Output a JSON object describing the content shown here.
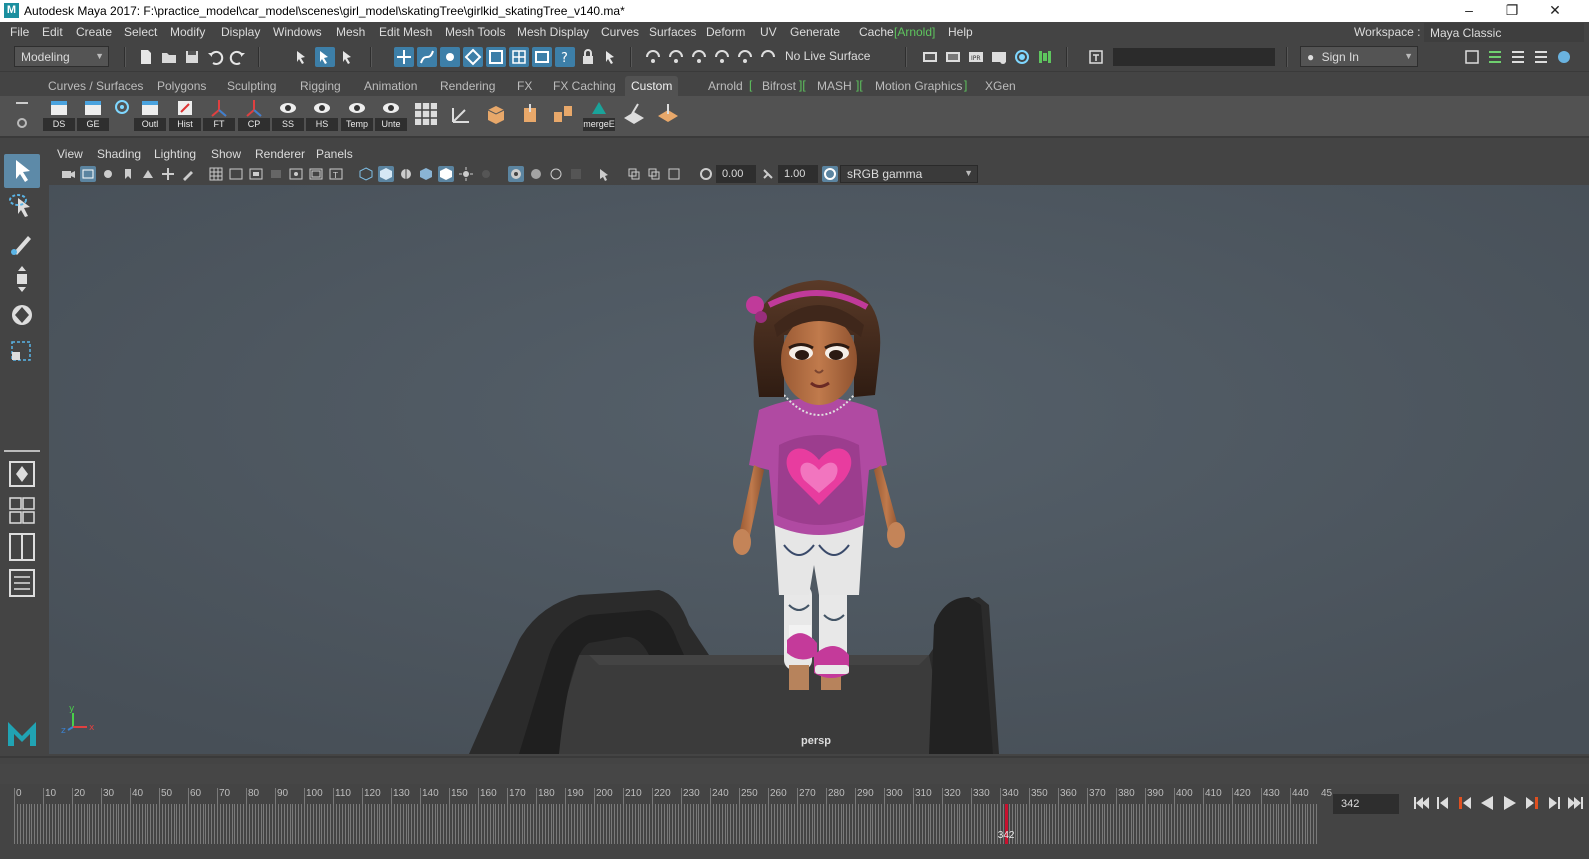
{
  "window": {
    "logo": "M",
    "title": "Autodesk Maya 2017: F:\\practice_model\\car_model\\scenes\\girl_model\\skatingTree\\girlkid_skatingTree_v140.ma*",
    "minimize_glyph": "–",
    "restore_glyph": "❐",
    "close_glyph": "✕"
  },
  "menubar": {
    "items": [
      "File",
      "Edit",
      "Create",
      "Select",
      "Modify",
      "Display",
      "Windows",
      "Mesh",
      "Edit Mesh",
      "Mesh Tools",
      "Mesh Display",
      "Curves",
      "Surfaces",
      "Deform",
      "UV",
      "Generate",
      "Cache",
      "[Arnold]",
      "Help"
    ],
    "workspace_label": "Workspace :",
    "workspace_value": "Maya Classic"
  },
  "statusline": {
    "mode": "Modeling",
    "live_surface": "No Live Surface",
    "sign_in": "Sign In"
  },
  "shelf": {
    "tabs": [
      "Curves / Surfaces",
      "Polygons",
      "Sculpting",
      "Rigging",
      "Animation",
      "Rendering",
      "FX",
      "FX Caching",
      "Custom",
      "Arnold",
      "Bifrost",
      "MASH",
      "Motion Graphics",
      "XGen"
    ],
    "active_tab": "Custom",
    "buttons": [
      "DS",
      "GE",
      "",
      "Outl",
      "Hist",
      "FT",
      "CP",
      "SS",
      "HS",
      "Temp",
      "Unte",
      "",
      "",
      "",
      "",
      "",
      "mergeE",
      "",
      ""
    ]
  },
  "panel": {
    "menu": [
      "View",
      "Shading",
      "Lighting",
      "Show",
      "Renderer",
      "Panels"
    ],
    "exposure": "0.00",
    "gamma": "1.00",
    "color_space": "sRGB gamma",
    "camera_label": "persp"
  },
  "axis": {
    "y": "y",
    "x": "x",
    "z": "z"
  },
  "timeline": {
    "ticks": [
      "0",
      "10",
      "20",
      "30",
      "40",
      "50",
      "60",
      "70",
      "80",
      "90",
      "100",
      "110",
      "120",
      "130",
      "140",
      "150",
      "160",
      "170",
      "180",
      "190",
      "200",
      "210",
      "220",
      "230",
      "240",
      "250",
      "260",
      "270",
      "280",
      "290",
      "300",
      "310",
      "320",
      "330",
      "340",
      "350",
      "360",
      "370",
      "380",
      "390",
      "400",
      "410",
      "420",
      "430",
      "440",
      "45"
    ],
    "current_frame": "342",
    "current_frame_field": "342"
  },
  "colors": {
    "ui_bg": "#444444",
    "viewport_bg": "#4b545d",
    "accent_blue": "#5d8aa8",
    "arnold_green": "#5ec55e",
    "playhead": "#c8102e"
  }
}
